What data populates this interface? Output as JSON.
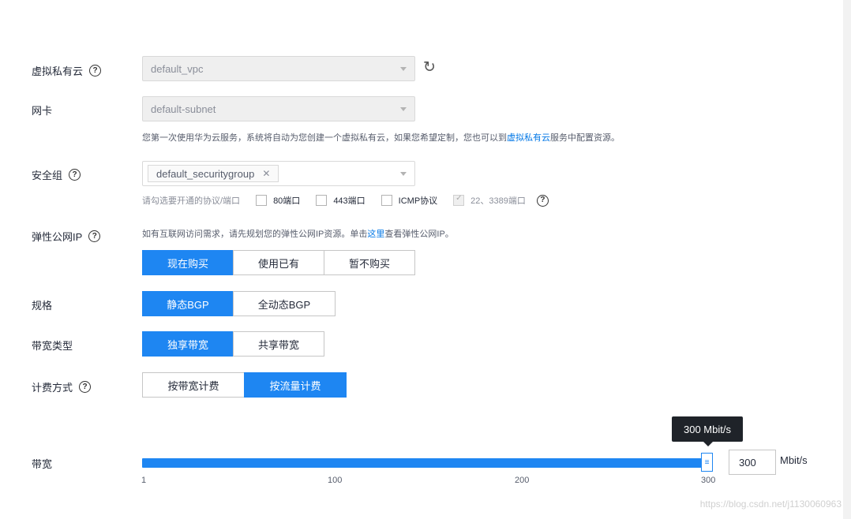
{
  "vpc": {
    "label": "虚拟私有云",
    "value": "default_vpc"
  },
  "nic": {
    "label": "网卡",
    "value": "default-subnet",
    "hint_prefix": "您第一次使用华为云服务，系统将自动为您创建一个虚拟私有云，如果您希望定制，您也可以到",
    "hint_link": "虚拟私有云",
    "hint_suffix": "服务中配置资源。"
  },
  "security_group": {
    "label": "安全组",
    "tag": "default_securitygroup",
    "ports_hint": "请勾选要开通的协议/端口",
    "options": [
      "80端口",
      "443端口",
      "ICMP协议"
    ],
    "disabled_option": "22、3389端口"
  },
  "eip": {
    "label": "弹性公网IP",
    "hint_prefix": "如有互联网访问需求，请先规划您的弹性公网IP资源。单击",
    "hint_link": "这里",
    "hint_suffix": "查看弹性公网IP。",
    "options": [
      "现在购买",
      "使用已有",
      "暂不购买"
    ],
    "selected": "现在购买"
  },
  "spec": {
    "label": "规格",
    "options": [
      "静态BGP",
      "全动态BGP"
    ],
    "selected": "静态BGP"
  },
  "bandwidth_type": {
    "label": "带宽类型",
    "options": [
      "独享带宽",
      "共享带宽"
    ],
    "selected": "独享带宽"
  },
  "billing": {
    "label": "计费方式",
    "options": [
      "按带宽计费",
      "按流量计费"
    ],
    "selected": "按流量计费"
  },
  "bandwidth": {
    "label": "带宽",
    "value": "300",
    "tooltip": "300 Mbit/s",
    "unit": "Mbit/s",
    "ticks": [
      "1",
      "100",
      "200",
      "300"
    ],
    "level": 1.0
  },
  "watermark": "https://blog.csdn.net/j1130060963"
}
